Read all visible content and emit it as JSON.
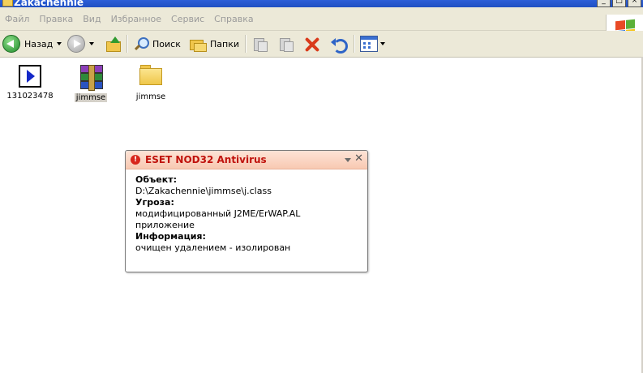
{
  "window": {
    "title": "Zakachennie"
  },
  "menu": [
    "Файл",
    "Правка",
    "Вид",
    "Избранное",
    "Сервис",
    "Справка"
  ],
  "toolbar": {
    "back_label": "Назад",
    "search_label": "Поиск",
    "folders_label": "Папки"
  },
  "files": [
    {
      "name": "131023478",
      "type": "exe"
    },
    {
      "name": "jimmse",
      "type": "rar"
    },
    {
      "name": "jimmse",
      "type": "folder"
    }
  ],
  "popup": {
    "title": "ESET NOD32 Antivirus",
    "object_label": "Объект:",
    "object_value": "D:\\Zakachennie\\jimmse\\j.class",
    "threat_label": "Угроза:",
    "threat_value_line1": "модифицированный J2ME/ErWAP.AL",
    "threat_value_line2": "приложение",
    "info_label": "Информация:",
    "info_value": "очищен удалением - изолирован"
  },
  "colors": {
    "accent": "#c0130d",
    "titlebar": "#2c5fd8",
    "chrome": "#ece9d8"
  }
}
